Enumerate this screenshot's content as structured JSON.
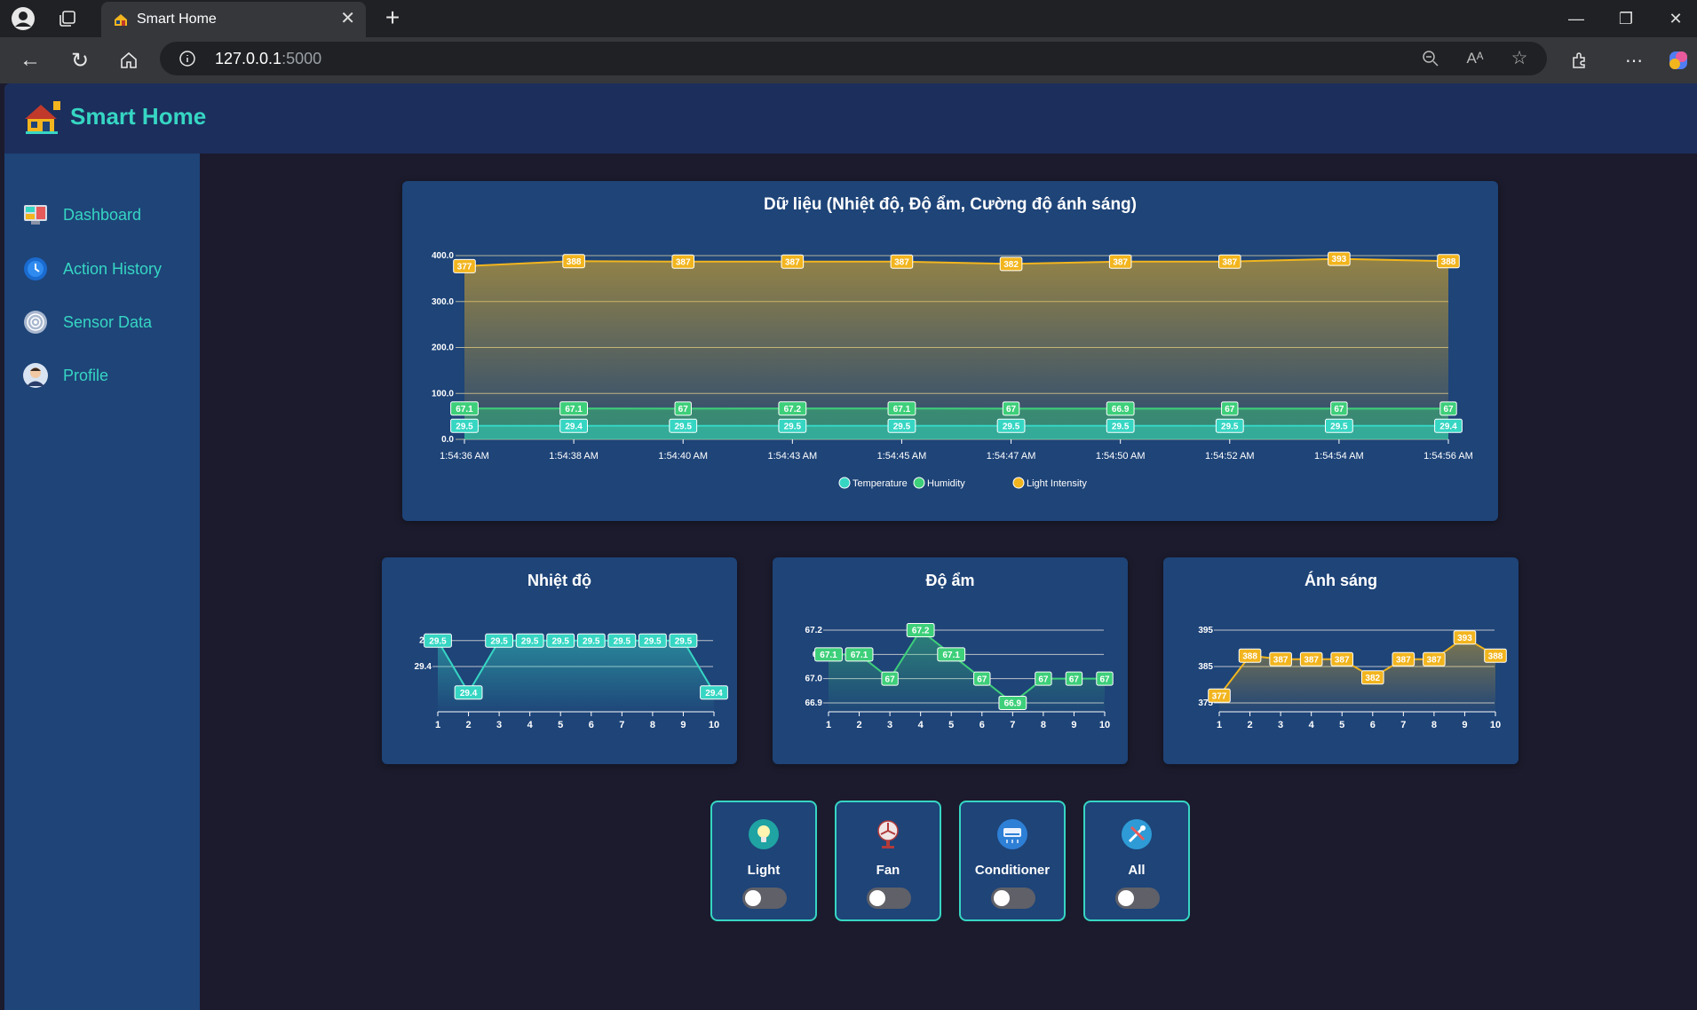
{
  "browser": {
    "tab_title": "Smart Home",
    "new_tab": "+",
    "url_host": "127.0.0.1",
    "url_port": ":5000"
  },
  "app": {
    "title": "Smart Home",
    "colors": {
      "accent": "#36d6c3",
      "header": "#1c2e5c",
      "sidebar": "#1e4478",
      "background": "#1b1b2d",
      "temperature": "#36d6c3",
      "humidity": "#3ecf7a",
      "light": "#f2b51e"
    }
  },
  "sidebar": {
    "items": [
      {
        "label": "Dashboard",
        "icon": "dashboard-icon"
      },
      {
        "label": "Action History",
        "icon": "history-icon"
      },
      {
        "label": "Sensor Data",
        "icon": "sensor-icon"
      },
      {
        "label": "Profile",
        "icon": "profile-icon"
      }
    ]
  },
  "devices": [
    {
      "label": "Light",
      "icon": "lightbulb-icon",
      "on": false
    },
    {
      "label": "Fan",
      "icon": "fan-icon",
      "on": false
    },
    {
      "label": "Conditioner",
      "icon": "air-conditioner-icon",
      "on": false
    },
    {
      "label": "All",
      "icon": "tools-icon",
      "on": false
    }
  ],
  "chart_data": [
    {
      "type": "line",
      "title": "Dữ liệu (Nhiệt độ, Độ ẩm, Cường độ ánh sáng)",
      "categories": [
        "1:54:36 AM",
        "1:54:38 AM",
        "1:54:40 AM",
        "1:54:43 AM",
        "1:54:45 AM",
        "1:54:47 AM",
        "1:54:50 AM",
        "1:54:52 AM",
        "1:54:54 AM",
        "1:54:56 AM"
      ],
      "yticks": [
        "0.0",
        "100.0",
        "200.0",
        "300.0",
        "400.0"
      ],
      "ylim": [
        0,
        400
      ],
      "legend": "bottom",
      "series": [
        {
          "name": "Temperature",
          "color": "#36d6c3",
          "values": [
            29.5,
            29.4,
            29.5,
            29.5,
            29.5,
            29.5,
            29.5,
            29.5,
            29.5,
            29.4
          ]
        },
        {
          "name": "Humidity",
          "color": "#3ecf7a",
          "values": [
            67.1,
            67.1,
            67,
            67.2,
            67.1,
            67,
            66.9,
            67,
            67,
            67
          ]
        },
        {
          "name": "Light Intensity",
          "color": "#f2b51e",
          "values": [
            377,
            388,
            387,
            387,
            387,
            382,
            387,
            387,
            393,
            388
          ]
        }
      ]
    },
    {
      "type": "line",
      "title": "Nhiệt độ",
      "categories": [
        "1",
        "2",
        "3",
        "4",
        "5",
        "6",
        "7",
        "8",
        "9",
        "10"
      ],
      "yticks": [
        "29.4",
        "29."
      ],
      "series": [
        {
          "color": "#36d6c3",
          "values": [
            29.5,
            29.4,
            29.5,
            29.5,
            29.5,
            29.5,
            29.5,
            29.5,
            29.5,
            29.4
          ]
        }
      ]
    },
    {
      "type": "line",
      "title": "Độ ẩm",
      "categories": [
        "1",
        "2",
        "3",
        "4",
        "5",
        "6",
        "7",
        "8",
        "9",
        "10"
      ],
      "yticks": [
        "66.9",
        "67.0",
        "67",
        "67.2"
      ],
      "series": [
        {
          "color": "#3ecf7a",
          "values": [
            67.1,
            67.1,
            67,
            67.2,
            67.1,
            67,
            66.9,
            67,
            67,
            67
          ]
        }
      ]
    },
    {
      "type": "line",
      "title": "Ánh sáng",
      "categories": [
        "1",
        "2",
        "3",
        "4",
        "5",
        "6",
        "7",
        "8",
        "9",
        "10"
      ],
      "yticks": [
        "375",
        "385",
        "395"
      ],
      "series": [
        {
          "color": "#f2b51e",
          "values": [
            377,
            388,
            387,
            387,
            387,
            382,
            387,
            387,
            393,
            388
          ]
        }
      ]
    }
  ]
}
